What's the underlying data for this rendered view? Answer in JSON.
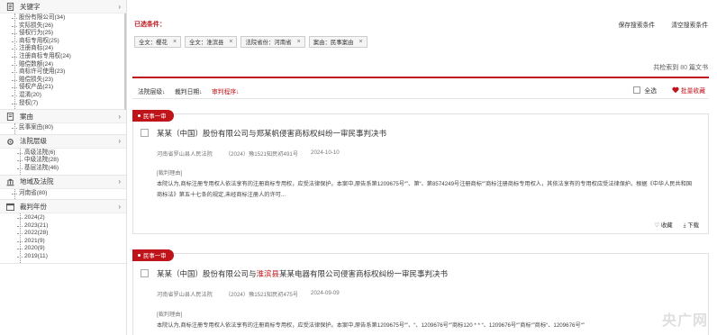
{
  "sidebar": {
    "sections": [
      {
        "title": "关键字",
        "icon": "document-icon",
        "chev": "›",
        "items": [
          "股份有限公司(34)",
          "实际损失(26)",
          "侵权行为(25)",
          "商标专用权(25)",
          "注册商标(24)",
          "注册商标专用权(24)",
          "赔偿数额(24)",
          "商标许可使用(23)",
          "赔偿损失(23)",
          "侵权产品(21)",
          "混淆(20)",
          "授权(7)"
        ]
      },
      {
        "title": "案由",
        "icon": "document-icon",
        "chev": "›",
        "items": [
          "民事案由(80)"
        ]
      },
      {
        "title": "法院层级",
        "icon": "gear-icon",
        "chev": "›",
        "items": [
          "高级法院(6)",
          "中级法院(28)",
          "基层法院(46)"
        ]
      },
      {
        "title": "地域及法院",
        "icon": "bank-icon",
        "chev": "›",
        "items": [
          "河南省(80)"
        ]
      },
      {
        "title": "裁判年份",
        "icon": "calendar-icon",
        "chev": "›",
        "items": [
          "2024(2)",
          "2023(21)",
          "2022(28)",
          "2021(9)",
          "2020(9)",
          "2019(11)"
        ]
      }
    ]
  },
  "filters": {
    "title": "已选条件：",
    "save": "保存搜索条件",
    "clear": "清空搜索条件",
    "chips": [
      {
        "label": "全文：樱花",
        "x": "×"
      },
      {
        "label": "全文：淮滨县",
        "x": "×"
      },
      {
        "label": "法院省份：河南省",
        "x": "×"
      },
      {
        "label": "案由：民事案由",
        "x": "×"
      }
    ]
  },
  "total": {
    "prefix": "共检索到",
    "count": "80",
    "suffix": "篇文书"
  },
  "sort": {
    "items": [
      {
        "label": "法院层级↓",
        "active": false
      },
      {
        "label": "裁判日期↓",
        "active": false
      },
      {
        "label": "审判程序↓",
        "active": true
      }
    ],
    "select_all": "全选",
    "batch_download": "批量收藏"
  },
  "results": [
    {
      "tag": "民事一审",
      "title_parts": [
        "某某（中国）股份有限公司与郑某帆侵害商标权纠纷一审民事判决书"
      ],
      "court": "河南省罗山县人民法院",
      "case_no": "（2024）豫1521知民初491号",
      "date": "2024-10-10",
      "reason_label": "[裁判理由]",
      "body": "本院认为,商标注册专用权人依法享有的注册商标专用权，应受法律保护。本案中,原告系第1209675号“”、第“、第8574249号注册商标“”商标注册商标专用权人，其依法享有的专用权应受法律保护。根据《中华人民共和国商标法》第五十七条的规定,未经商标注册人的许可...",
      "fav": "收藏",
      "download": "下载"
    },
    {
      "tag": "民事一审",
      "title_pre": "某某（中国）股份有限公司与",
      "title_hl": "淮滨县",
      "title_post": "某某电器有限公司侵害商标权纠纷一审民事判决书",
      "court": "河南省罗山县人民法院",
      "case_no": "（2024）豫1521知民初475号",
      "date": "2024-09-09",
      "reason_label": "[裁判理由]",
      "body": "本院认为,商标注册专用权人依法享有的注册商标专用权，应受法律保护。本案中,原告系第1209675号“”、“、1209676号“”商标120 * * “、1209676号“”商标“”商标“、1209676号“”"
    }
  ],
  "watermark": "央广网"
}
